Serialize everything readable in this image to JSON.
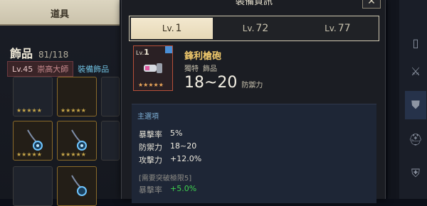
{
  "left_panel": {
    "header_title": "道具",
    "category": "飾品",
    "count": "81/118",
    "level_label": "Lv.45",
    "level_title": "崇高大師",
    "category_link": "裝備飾品"
  },
  "dialog": {
    "title": "裝備資訊",
    "close_symbol": "✕",
    "tabs": [
      {
        "prefix": "Lv.",
        "num": "1"
      },
      {
        "prefix": "Lv.",
        "num": "72"
      },
      {
        "prefix": "Lv.",
        "num": "77"
      }
    ],
    "item": {
      "lv_prefix": "Lv.",
      "lv_num": "1",
      "stars": "★★★★★",
      "name": "鋒利槍砲",
      "tag1": "獨特",
      "tag2": "飾品",
      "value": "18~20",
      "value_label": "防禦力"
    },
    "main_options": {
      "heading": "主選項",
      "stats": [
        {
          "key": "暴擊率",
          "value": "5%"
        },
        {
          "key": "防禦力",
          "value": "18~20"
        },
        {
          "key": "攻擊力",
          "value": "+12.0%"
        }
      ],
      "note": "[需要突破極限5]",
      "locked_stat": {
        "key": "暴擊率",
        "value": "+5.0%"
      }
    }
  },
  "colors": {
    "accent_gold": "#f0c96c",
    "positive_green": "#3fd24e",
    "item_border": "#b8503a"
  }
}
